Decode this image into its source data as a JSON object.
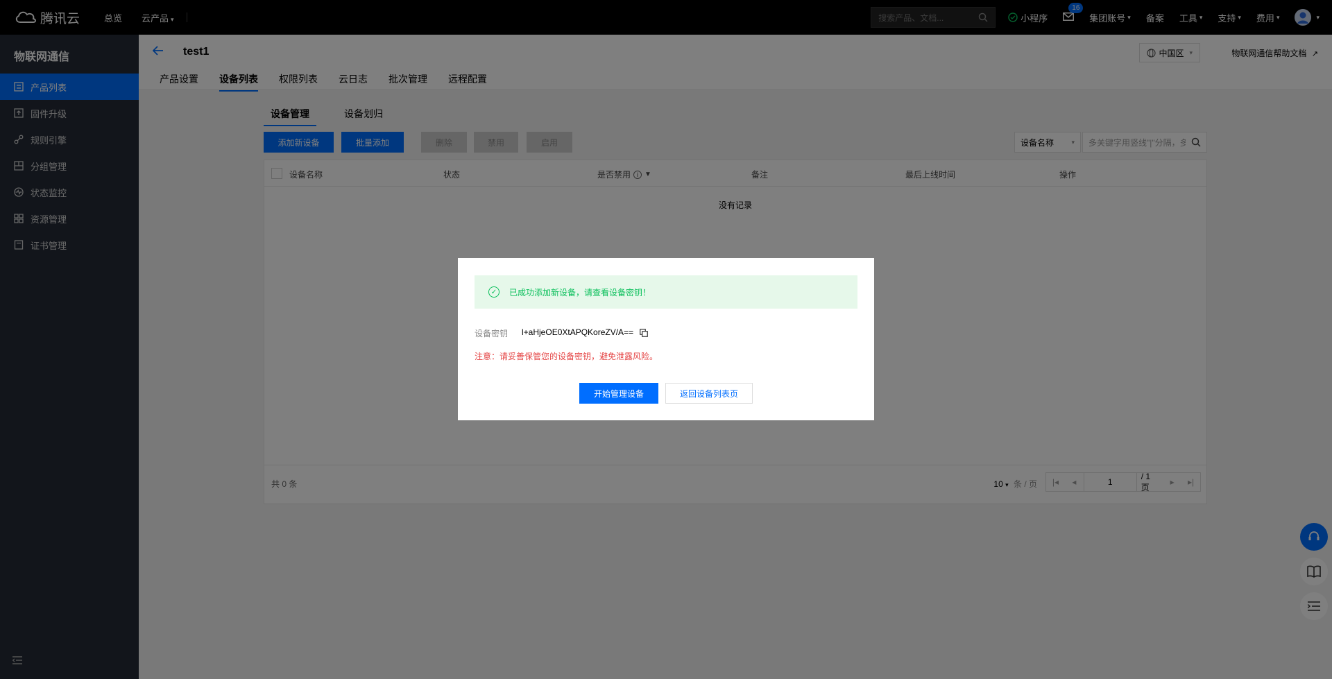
{
  "topnav": {
    "logo_text": "腾讯云",
    "overview": "总览",
    "cloud_products": "云产品",
    "search_placeholder": "搜索产品、文档...",
    "mini_program": "小程序",
    "mail_count": "16",
    "group_account": "集团账号",
    "filing": "备案",
    "tools": "工具",
    "support": "支持",
    "billing": "费用"
  },
  "sidebar": {
    "title": "物联网通信",
    "items": [
      {
        "label": "产品列表",
        "icon": "product-list-icon",
        "active": true
      },
      {
        "label": "固件升级",
        "icon": "firmware-icon"
      },
      {
        "label": "规则引擎",
        "icon": "rule-engine-icon"
      },
      {
        "label": "分组管理",
        "icon": "group-icon"
      },
      {
        "label": "状态监控",
        "icon": "monitor-icon"
      },
      {
        "label": "资源管理",
        "icon": "resource-icon"
      },
      {
        "label": "证书管理",
        "icon": "certificate-icon"
      }
    ]
  },
  "header": {
    "title": "test1",
    "region": "中国区",
    "help": "物联网通信帮助文档",
    "tabs": [
      "产品设置",
      "设备列表",
      "权限列表",
      "云日志",
      "批次管理",
      "远程配置"
    ]
  },
  "main": {
    "subtabs": [
      "设备管理",
      "设备划归"
    ],
    "toolbar": {
      "add_device": "添加新设备",
      "batch_add": "批量添加",
      "delete": "删除",
      "disable": "禁用",
      "enable": "启用",
      "filter_select": "设备名称",
      "search_placeholder": "多关键字用竖线\"|\"分隔，多个过滤标签用回车键分隔"
    },
    "table": {
      "columns": [
        "设备名称",
        "状态",
        "是否禁用",
        "备注",
        "最后上线时间",
        "操作"
      ],
      "empty": "没有记录",
      "total": "共 0 条",
      "page_size": "10",
      "per_page_label": "条 / 页",
      "page": "1",
      "page_total": "/ 1 页"
    }
  },
  "modal": {
    "success_text": "已成功添加新设备，请查看设备密钥！",
    "key_label": "设备密钥",
    "key_value": "l+aHjeOE0XtAPQKoreZV/A==",
    "warning": "注意：请妥善保管您的设备密钥，避免泄露风险。",
    "start_button": "开始管理设备",
    "back_button": "返回设备列表页"
  },
  "colors": {
    "primary": "#006eff",
    "success": "#0abf5b",
    "danger": "#e54545"
  }
}
